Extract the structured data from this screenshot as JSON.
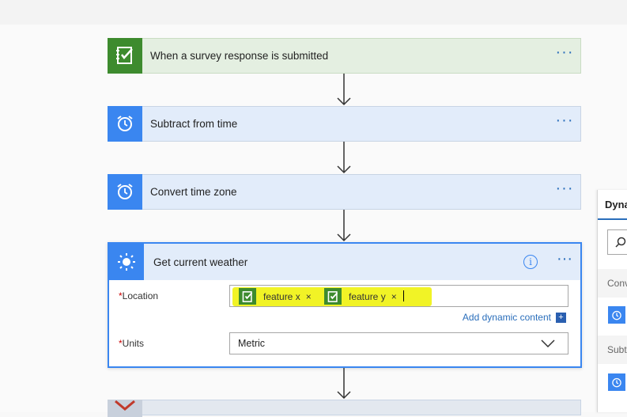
{
  "steps": [
    {
      "title": "When a survey response is submitted",
      "more": "···",
      "icon": "survey-icon"
    },
    {
      "title": "Subtract from time",
      "more": "···",
      "icon": "alarm-clock-icon"
    },
    {
      "title": "Convert time zone",
      "more": "···",
      "icon": "alarm-clock-icon"
    }
  ],
  "weather": {
    "title": "Get current weather",
    "info_icon": "i",
    "more": "···",
    "location_label": "Location",
    "units_label": "Units",
    "required_mark": "*",
    "tokens": [
      {
        "label": "feature x",
        "remove": "×"
      },
      {
        "label": "feature y",
        "remove": "×"
      }
    ],
    "add_dynamic_content": "Add dynamic content",
    "add_plus": "+",
    "units_value": "Metric"
  },
  "side_panel": {
    "title": "Dyna",
    "section1": "Conv",
    "section2": "Subt"
  },
  "colors": {
    "accent_blue": "#3a86f0",
    "survey_green": "#3d8b2e",
    "highlight_yellow": "#f0f21a"
  }
}
